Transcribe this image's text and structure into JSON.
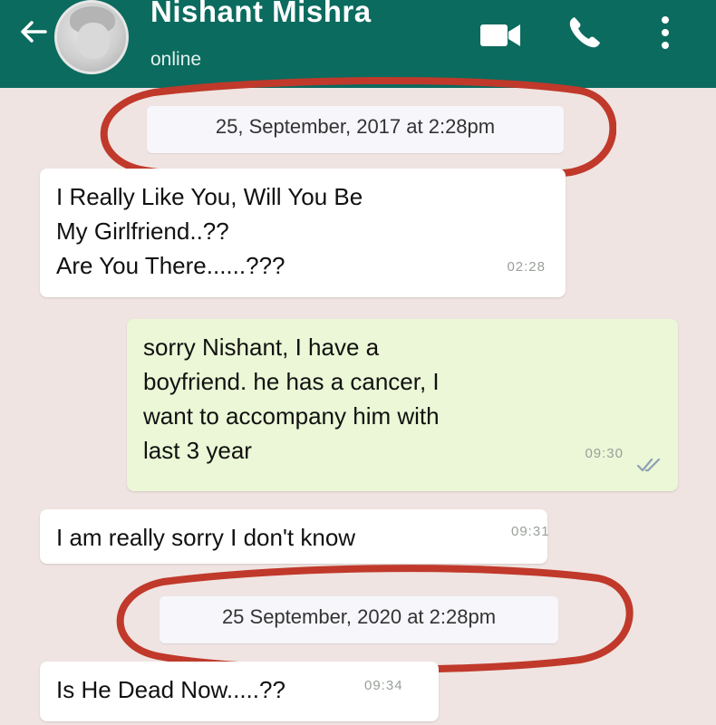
{
  "header": {
    "contact_name": "Nishant Mishra",
    "status": "online",
    "icons": [
      "back-arrow-icon",
      "avatar",
      "video-call-icon",
      "voice-call-icon",
      "more-menu-icon"
    ]
  },
  "dates": [
    "25, September, 2017 at 2:28pm",
    "25 September, 2020 at 2:28pm"
  ],
  "messages": [
    {
      "direction": "incoming",
      "text": "I Really Like You, Will You Be\nMy Girlfriend..??\nAre You There......???",
      "time": "02:28"
    },
    {
      "direction": "outgoing",
      "text": "sorry Nishant, I have a\nboyfriend. he has a cancer, I\nwant to accompany him with\nlast 3 year",
      "time": "09:30",
      "status": "read"
    },
    {
      "direction": "incoming",
      "text": "I am really sorry I don't know",
      "time": "09:31"
    },
    {
      "direction": "incoming",
      "text": "Is He Dead Now.....??",
      "time": "09:34"
    }
  ],
  "colors": {
    "header": "#0b6b5e",
    "background": "#efe4e1",
    "incoming_bubble": "#ffffff",
    "outgoing_bubble": "#ebf7d6",
    "annotation_circle": "#c0392b"
  }
}
